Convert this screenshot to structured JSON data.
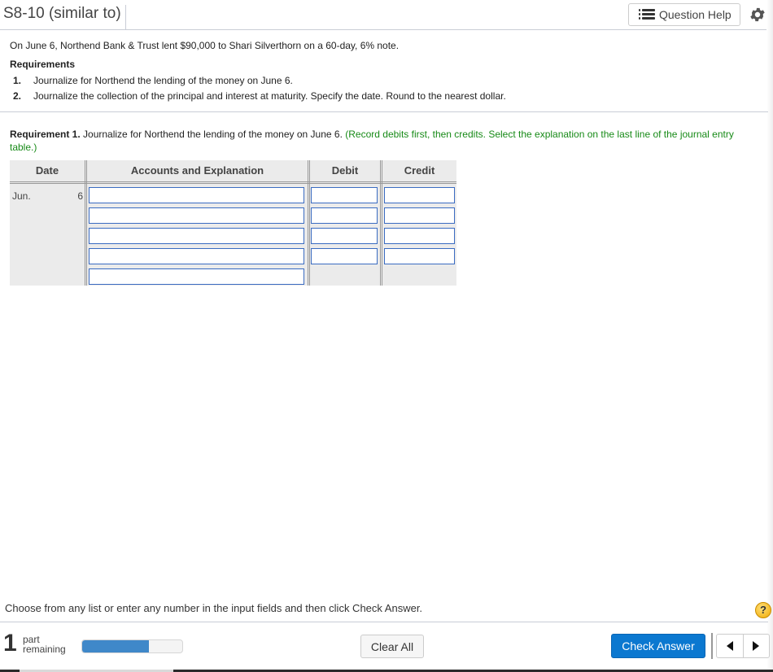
{
  "header": {
    "title": "S8-10 (similar to)",
    "question_help_label": "Question Help",
    "icons": {
      "question_help": "list-icon",
      "settings": "gear-icon"
    }
  },
  "problem": {
    "statement": "On June 6, Northend Bank & Trust lent $90,000 to Shari Silverthorn on a 60-day, 6% note.",
    "requirements_title": "Requirements",
    "requirements": [
      {
        "num": "1.",
        "text": "Journalize for Northend the lending of the money on June 6."
      },
      {
        "num": "2.",
        "text": "Journalize the collection of the principal and interest at maturity. Specify the date. Round to the nearest dollar."
      }
    ]
  },
  "requirement1": {
    "label": "Requirement 1.",
    "text": " Journalize for Northend the lending of the money on June 6. ",
    "hint": "(Record debits first, then credits. Select the explanation on the last line of the journal entry table.)"
  },
  "journal": {
    "headers": {
      "date": "Date",
      "accounts": "Accounts and Explanation",
      "debit": "Debit",
      "credit": "Credit"
    },
    "date_month": "Jun.",
    "date_day": "6",
    "rows": [
      {
        "account": "",
        "debit": "",
        "credit": ""
      },
      {
        "account": "",
        "debit": "",
        "credit": ""
      },
      {
        "account": "",
        "debit": "",
        "credit": ""
      },
      {
        "account": "",
        "debit": "",
        "credit": ""
      }
    ],
    "explanation": ""
  },
  "footer": {
    "instruction": "Choose from any list or enter any number in the input fields and then click Check Answer.",
    "help_icon_label": "?",
    "parts_count": "1",
    "parts_label_1": "part",
    "parts_label_2": "remaining",
    "progress_fraction": 0.67,
    "clear_all_label": "Clear All",
    "check_answer_label": "Check Answer",
    "accent_color": "#0b78d0"
  }
}
